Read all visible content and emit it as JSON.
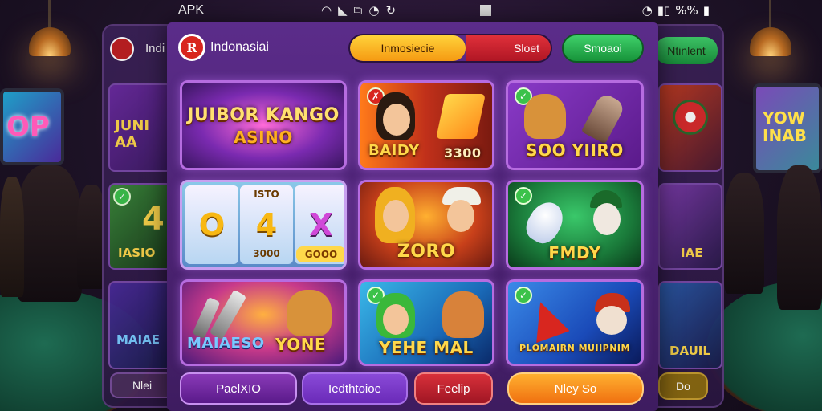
{
  "status_bar": {
    "left_text": "APK",
    "battery_text": "%%"
  },
  "header": {
    "brand_name": "Indonasiai",
    "segment_a_label": "Inmosiecie",
    "segment_b_label": "Sloet",
    "green_button_label": "Smoaoi",
    "logo_text": "R"
  },
  "left_ghost": {
    "brand_name": "Indi",
    "tile_1_text": "JUNI AA",
    "tile_2_text": "4",
    "tile_2_sub": "IASIO",
    "tile_3_text": "MAIAE",
    "button_label": "Nlei"
  },
  "right_ghost": {
    "header_label": "Ntinlent",
    "tile_2_text": "IAE",
    "tile_3_text": "DAUIL",
    "button_label": "Do"
  },
  "background_screens": {
    "left_sign": "OP",
    "right_sign": "YOW INAB"
  },
  "games": [
    {
      "title_line1": "JUIBOR KANGO",
      "title_line2": "ASINO"
    },
    {
      "title_left": "BAIDY",
      "title_right": "3300"
    },
    {
      "title": "SOO YIIRO"
    },
    {
      "reel_1": "O",
      "reel_2": "4",
      "reel_3": "X",
      "reel_2_top": "ISTO",
      "reel_2_bottom": "3000",
      "reel_3_bottom": "GOOO"
    },
    {
      "title": "ZORO"
    },
    {
      "title": "FMDY"
    },
    {
      "title_left": "MAIAESO",
      "title_right": "YONE"
    },
    {
      "title": "YEHE MAL"
    },
    {
      "title": "PLOMAIRN MUIIPNIM"
    }
  ],
  "bottom_buttons": {
    "button_1": "PaelXIO",
    "button_2": "Iedthtoioe",
    "button_3": "Feelip",
    "button_4": "Nley So"
  },
  "colors": {
    "panel": "#5b2c8a",
    "segment_a": "#f5b020",
    "segment_b": "#c81f2c",
    "green": "#2bb050",
    "tile_border": "#b66ce0",
    "title_gold": "#ffd84a"
  }
}
